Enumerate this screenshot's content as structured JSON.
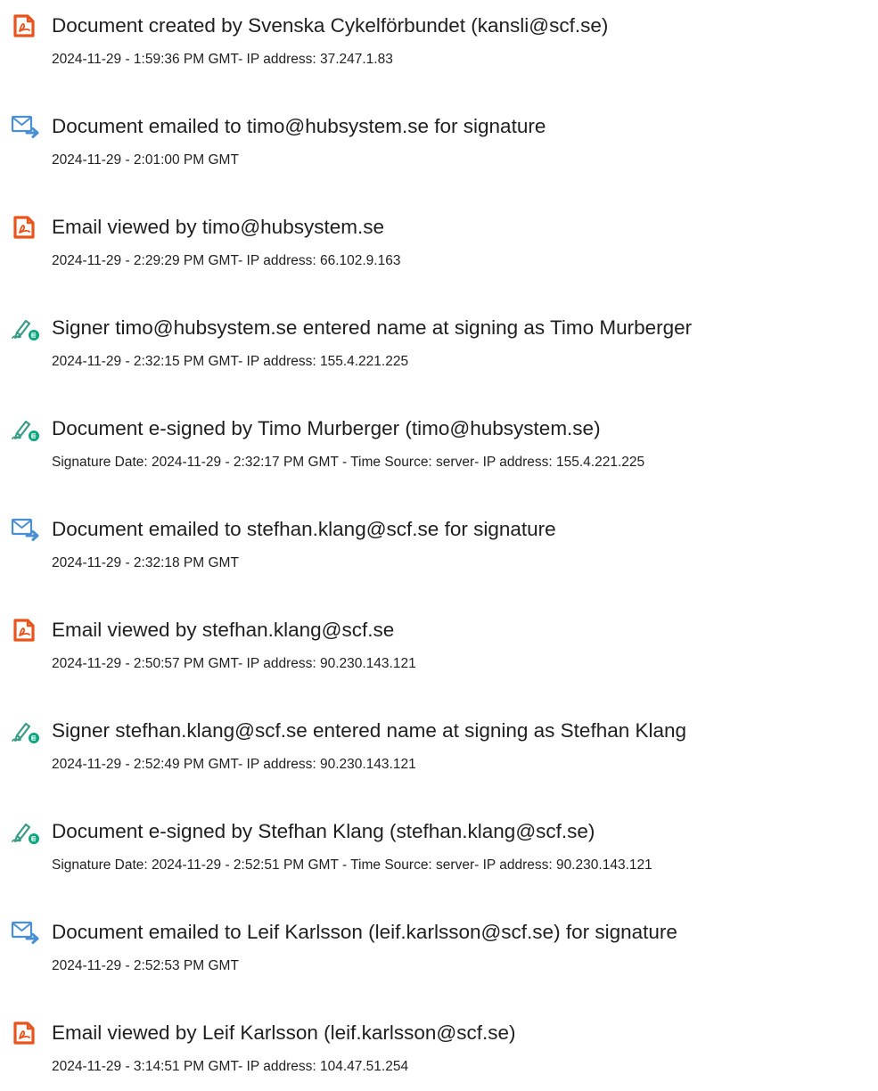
{
  "icon_colors": {
    "document": "#e8541c",
    "email": "#4a8fd4",
    "signature": "#3a9b86",
    "signature_accent": "#0da77f"
  },
  "events": [
    {
      "icon": "document-icon",
      "title": "Document created by Svenska Cykelförbundet (kansli@scf.se)",
      "detail": "2024-11-29 - 1:59:36 PM GMT- IP address: 37.247.1.83"
    },
    {
      "icon": "email-send-icon",
      "title": "Document emailed to timo@hubsystem.se for signature",
      "detail": "2024-11-29 - 2:01:00 PM GMT"
    },
    {
      "icon": "document-icon",
      "title": "Email viewed by timo@hubsystem.se",
      "detail": "2024-11-29 - 2:29:29 PM GMT- IP address: 66.102.9.163"
    },
    {
      "icon": "signature-pen-icon",
      "title": "Signer timo@hubsystem.se entered name at signing as Timo Murberger",
      "detail": "2024-11-29 - 2:32:15 PM GMT- IP address: 155.4.221.225"
    },
    {
      "icon": "signature-pen-icon",
      "title": "Document e-signed by Timo Murberger (timo@hubsystem.se)",
      "detail": "Signature Date: 2024-11-29 - 2:32:17 PM GMT - Time Source: server- IP address: 155.4.221.225"
    },
    {
      "icon": "email-send-icon",
      "title": "Document emailed to stefhan.klang@scf.se for signature",
      "detail": "2024-11-29 - 2:32:18 PM GMT"
    },
    {
      "icon": "document-icon",
      "title": "Email viewed by stefhan.klang@scf.se",
      "detail": "2024-11-29 - 2:50:57 PM GMT- IP address: 90.230.143.121"
    },
    {
      "icon": "signature-pen-icon",
      "title": "Signer stefhan.klang@scf.se entered name at signing as Stefhan Klang",
      "detail": "2024-11-29 - 2:52:49 PM GMT- IP address: 90.230.143.121"
    },
    {
      "icon": "signature-pen-icon",
      "title": "Document e-signed by Stefhan Klang (stefhan.klang@scf.se)",
      "detail": "Signature Date: 2024-11-29 - 2:52:51 PM GMT - Time Source: server- IP address: 90.230.143.121"
    },
    {
      "icon": "email-send-icon",
      "title": "Document emailed to Leif Karlsson (leif.karlsson@scf.se) for signature",
      "detail": "2024-11-29 - 2:52:53 PM GMT"
    },
    {
      "icon": "document-icon",
      "title": "Email viewed by Leif Karlsson (leif.karlsson@scf.se)",
      "detail": "2024-11-29 - 3:14:51 PM GMT- IP address: 104.47.51.254"
    }
  ]
}
